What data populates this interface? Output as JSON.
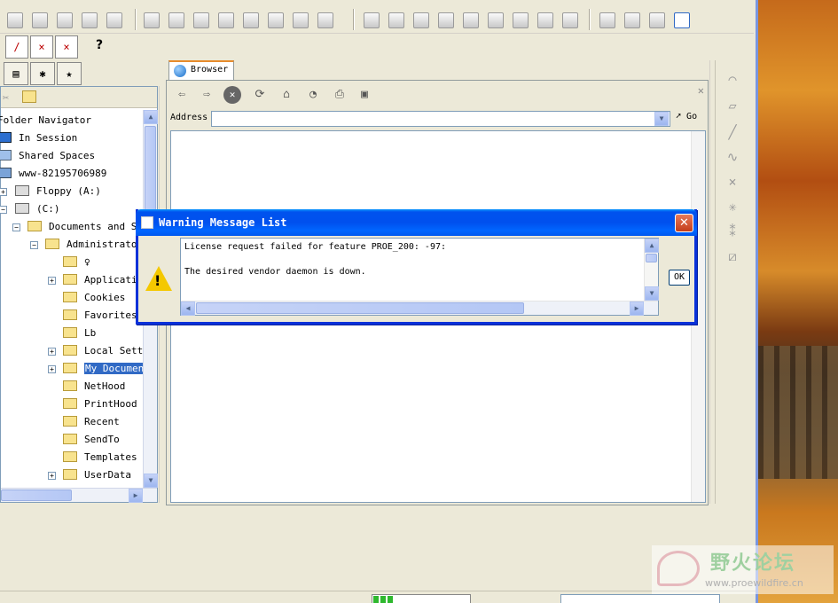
{
  "browser": {
    "tab_label": "Browser",
    "address_label": "Address",
    "address_value": "",
    "go_label": "Go"
  },
  "folder_navigator": {
    "title": "Folder Navigator",
    "items": [
      {
        "label": "In Session"
      },
      {
        "label": "Shared Spaces"
      },
      {
        "label": "www-82195706989"
      },
      {
        "label": "Floppy (A:)"
      },
      {
        "label": "(C:)"
      },
      {
        "label": "Documents and Se"
      },
      {
        "label": "Administrator"
      },
      {
        "label": "♀"
      },
      {
        "label": "Applicati"
      },
      {
        "label": "Cookies"
      },
      {
        "label": "Favorites"
      },
      {
        "label": "Lb"
      },
      {
        "label": "Local Sett"
      },
      {
        "label": "My Documen"
      },
      {
        "label": "NetHood"
      },
      {
        "label": "PrintHood"
      },
      {
        "label": "Recent"
      },
      {
        "label": "SendTo"
      },
      {
        "label": "Templates"
      },
      {
        "label": "UserData"
      }
    ]
  },
  "dialog": {
    "title": "Warning Message List",
    "line1": "License request failed for feature PROE_200: -97:",
    "line2": "The desired vendor daemon is down.",
    "ok_label": "OK",
    "close_label": "✕"
  },
  "status": {
    "progress": 0.2
  },
  "watermark": {
    "title": "野火论坛",
    "url": "www.proewildfire.cn"
  },
  "help_cursor": "?",
  "colors": {
    "title_bar": "#0054e3",
    "selection": "#316ac5",
    "close_button": "#c33d1a",
    "warning": "#f4c800"
  }
}
